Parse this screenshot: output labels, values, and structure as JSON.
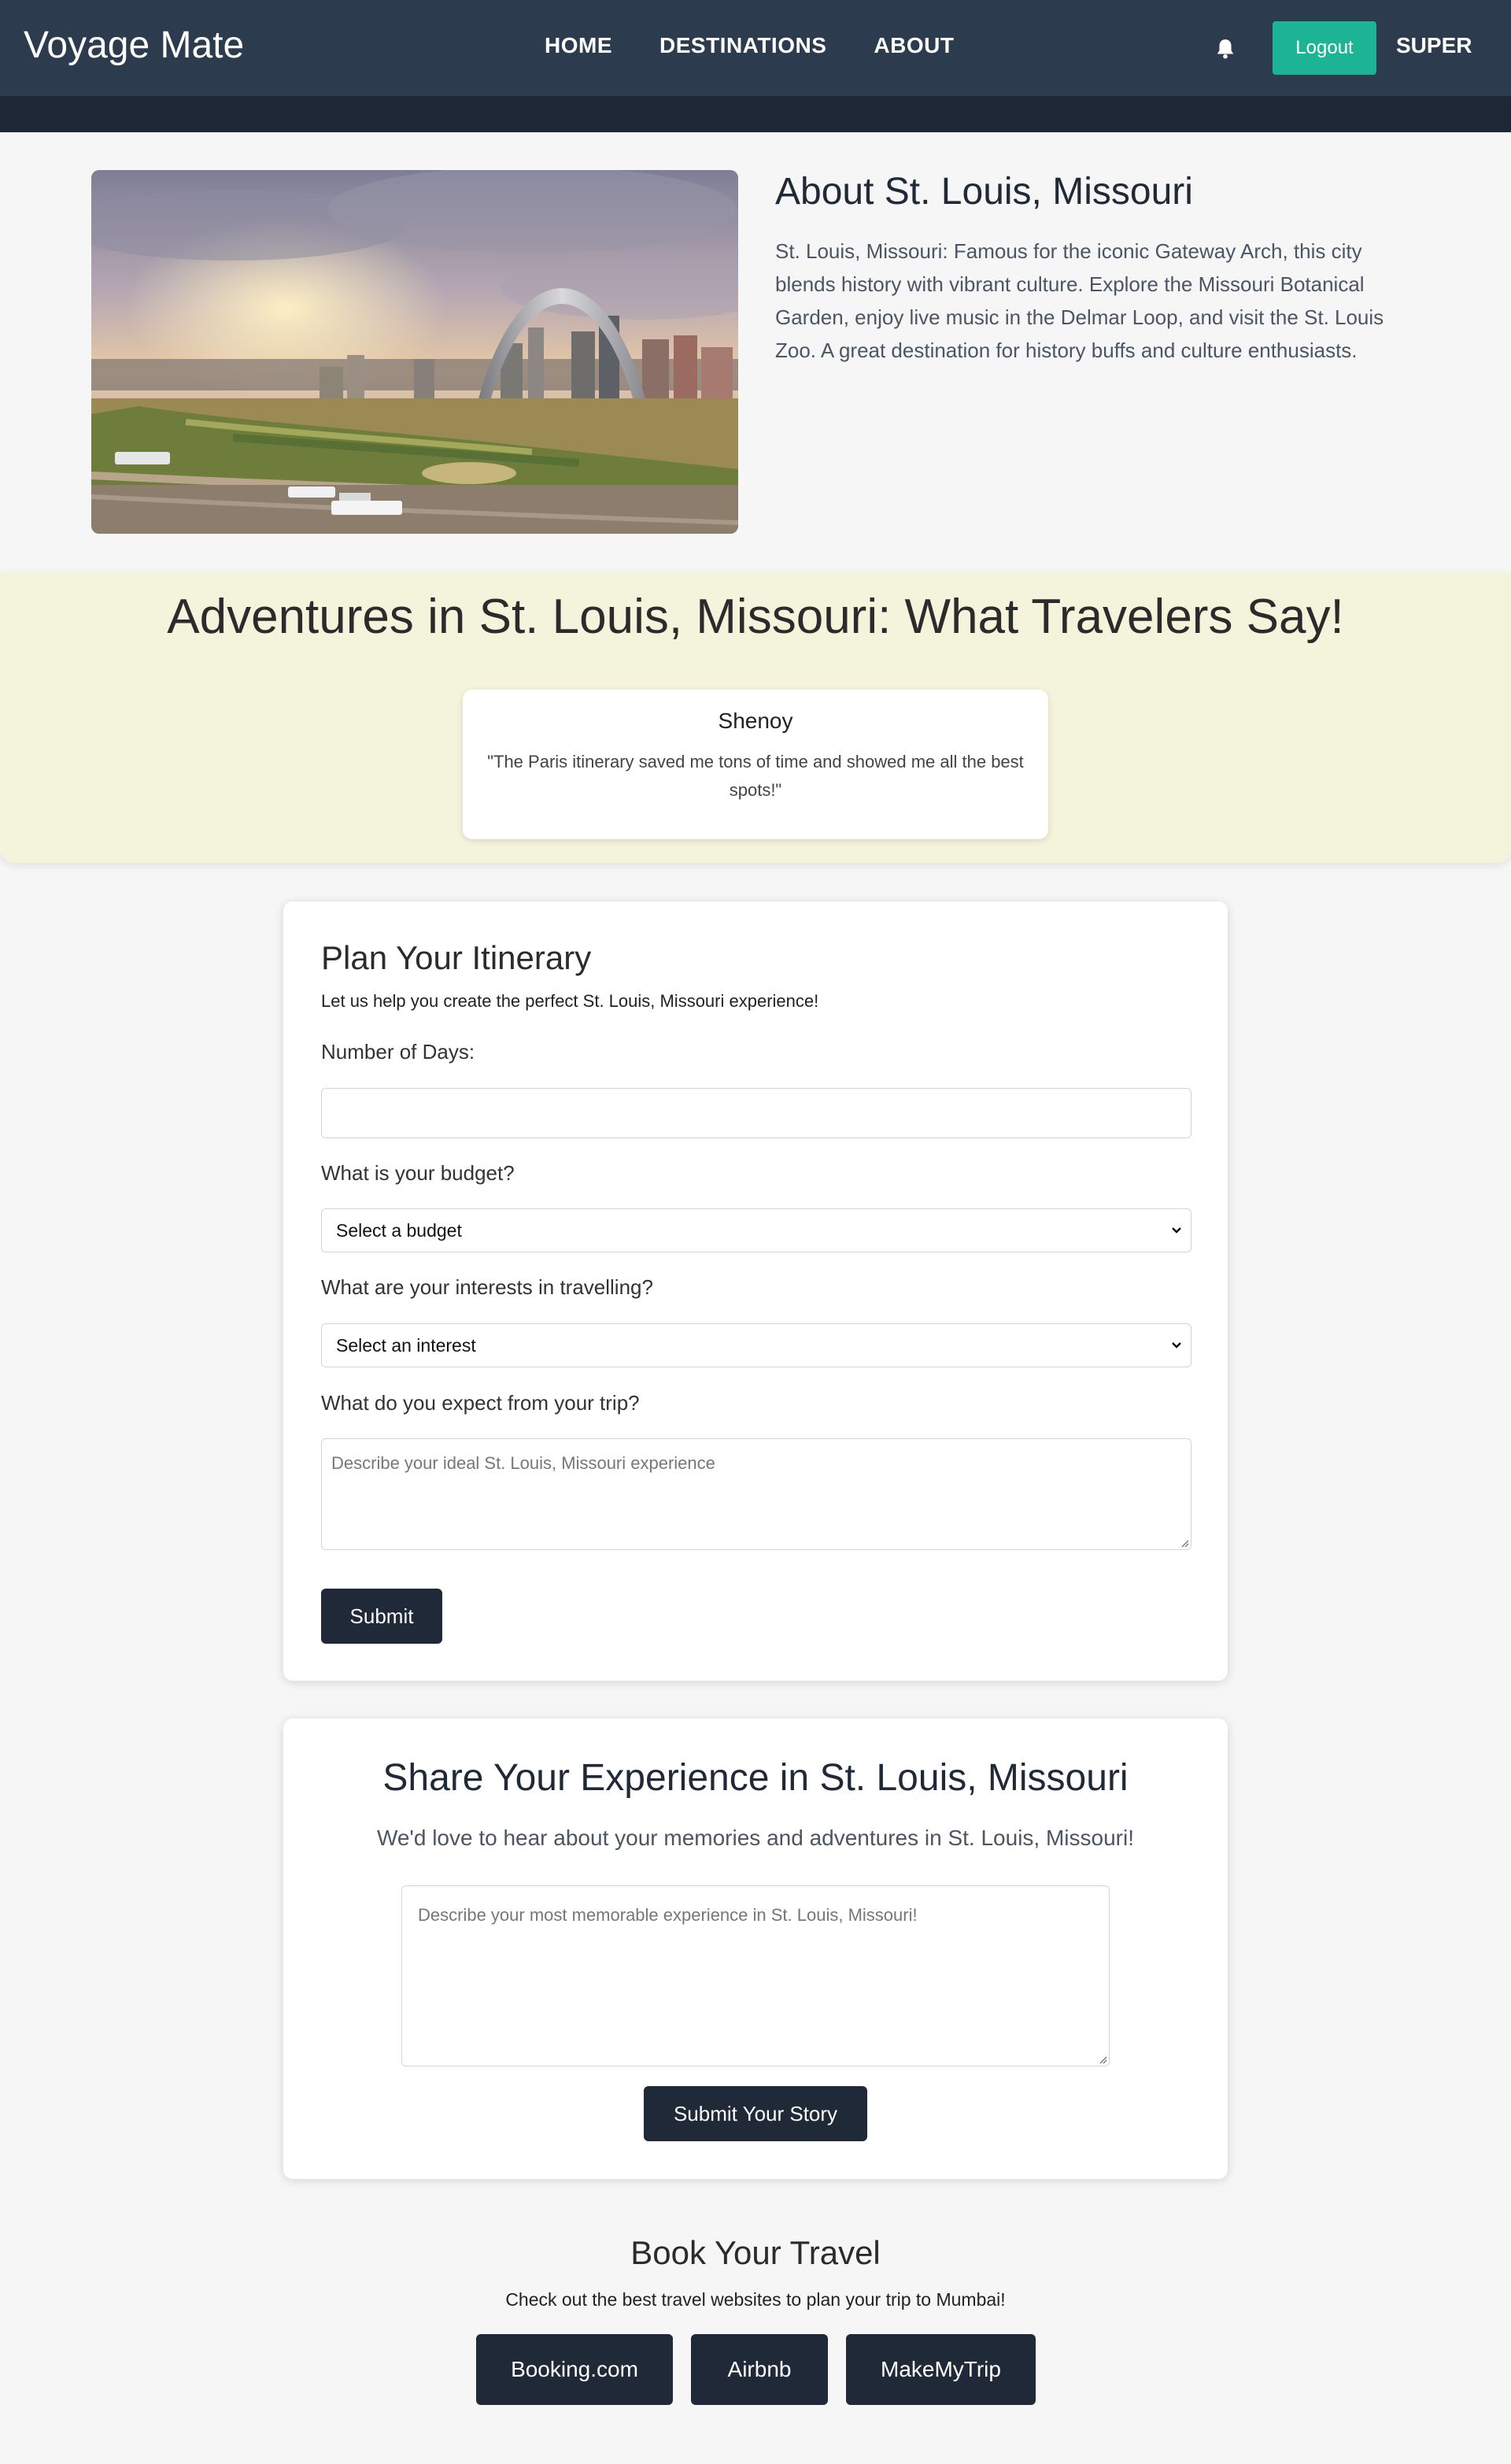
{
  "nav": {
    "brand": "Voyage Mate",
    "links": [
      "HOME",
      "DESTINATIONS",
      "ABOUT"
    ],
    "logout_label": "Logout",
    "user_name": "SUPER",
    "bell_icon": "bell-icon"
  },
  "about": {
    "title": "About St. Louis, Missouri",
    "description": "St. Louis, Missouri: Famous for the iconic Gateway Arch, this city blends history with vibrant culture. Explore the Missouri Botanical Garden, enjoy live music in the Delmar Loop, and visit the St. Louis Zoo. A great destination for history buffs and culture enthusiasts."
  },
  "testimonials": {
    "title": "Adventures in St. Louis, Missouri: What Travelers Say!",
    "items": [
      {
        "name": "Shenoy",
        "quote": "\"The Paris itinerary saved me tons of time and showed me all the best spots!\""
      }
    ]
  },
  "plan": {
    "title": "Plan Your Itinerary",
    "subtitle": "Let us help you create the perfect St. Louis, Missouri experience!",
    "days_label": "Number of Days:",
    "days_value": "",
    "budget_label": "What is your budget?",
    "budget_selected": "Select a budget",
    "interest_label": "What are your interests in travelling?",
    "interest_selected": "Select an interest",
    "expect_label": "What do you expect from your trip?",
    "expect_placeholder": "Describe your ideal St. Louis, Missouri experience",
    "submit_label": "Submit"
  },
  "share": {
    "title": "Share Your Experience in St. Louis, Missouri",
    "subtitle": "We'd love to hear about your memories and adventures in St. Louis, Missouri!",
    "placeholder": "Describe your most memorable experience in St. Louis, Missouri!",
    "submit_label": "Submit Your Story"
  },
  "book": {
    "title": "Book Your Travel",
    "subtitle": "Check out the best travel websites to plan your trip to Mumbai!",
    "links": [
      "Booking.com",
      "Airbnb",
      "MakeMyTrip"
    ]
  },
  "colors": {
    "nav_bg": "#2d3b4e",
    "accent": "#1db495",
    "dark_button": "#1f2937",
    "testimonial_bg": "#f4f4dc"
  }
}
